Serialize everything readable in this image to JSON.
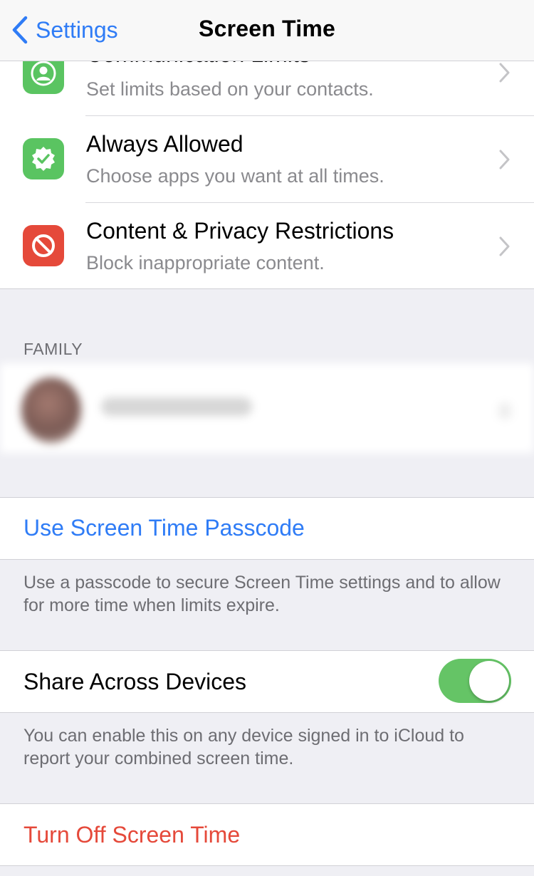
{
  "nav": {
    "back_label": "Settings",
    "title": "Screen Time"
  },
  "rows": [
    {
      "title": "Communication Limits",
      "subtitle": "Set limits based on your contacts.",
      "icon": "person-circle-icon",
      "color": "#5ac461"
    },
    {
      "title": "Always Allowed",
      "subtitle": "Choose apps you want at all times.",
      "icon": "checkmark-seal-icon",
      "color": "#5ac461"
    },
    {
      "title": "Content & Privacy Restrictions",
      "subtitle": "Block inappropriate content.",
      "icon": "no-entry-icon",
      "color": "#e5493a"
    }
  ],
  "family": {
    "header": "FAMILY"
  },
  "passcode": {
    "label": "Use Screen Time Passcode",
    "note": "Use a passcode to secure Screen Time settings and to allow for more time when limits expire."
  },
  "share": {
    "label": "Share Across Devices",
    "enabled": true,
    "note": "You can enable this on any device signed in to iCloud to report your combined screen time."
  },
  "turn_off": {
    "label": "Turn Off Screen Time"
  },
  "colors": {
    "accent": "#2f7cf6",
    "destructive": "#e5493a",
    "toggle_on": "#65c466"
  }
}
